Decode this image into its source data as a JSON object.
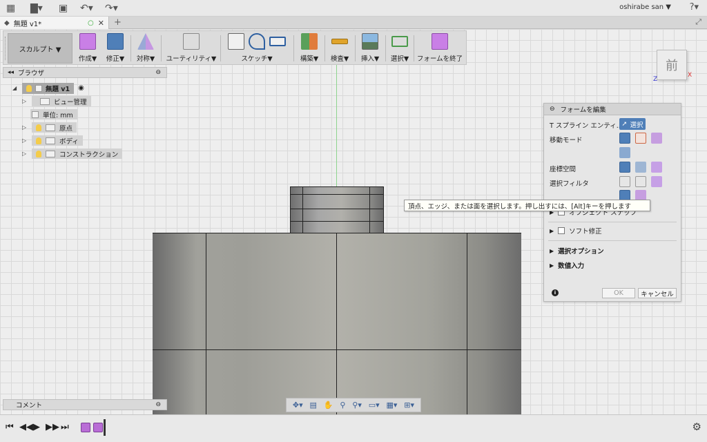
{
  "topbar": {
    "user_name": "oshirabe san ▼",
    "help_label": "?▾"
  },
  "document": {
    "tab_title": "無題 v1*"
  },
  "toolbar": {
    "workspace": "スカルプト ▼",
    "groups": [
      {
        "label": "作成▼"
      },
      {
        "label": "修正▼"
      },
      {
        "label": "対称▼"
      },
      {
        "label": "ユーティリティ▼"
      },
      {
        "label": "スケッチ▼"
      },
      {
        "label": "構築▼"
      },
      {
        "label": "検査▼"
      },
      {
        "label": "挿入▼"
      },
      {
        "label": "選択▼"
      },
      {
        "label": "フォームを終了"
      }
    ]
  },
  "browser": {
    "title": "ブラウザ",
    "root": "無題 v1",
    "items": [
      {
        "label": "ビュー管理"
      },
      {
        "label": "単位: mm"
      },
      {
        "label": "原点"
      },
      {
        "label": "ボディ"
      },
      {
        "label": "コンストラクション"
      }
    ]
  },
  "comment": {
    "title": "コメント"
  },
  "viewcube": {
    "face": "前",
    "x_axis": "X",
    "z_axis": "Z"
  },
  "edit_panel": {
    "title": "フォームを編集",
    "tspline_label": "T スプライン エンティ...",
    "select_button": "選択",
    "move_mode": "移動モード",
    "coordinate_space": "座標空間",
    "selection_filter": "選択フィルタ",
    "hidden_row": "オブジェクト スナップ",
    "soft_modify": "ソフト修正",
    "selection_options": "選択オプション",
    "numeric_input": "数値入力",
    "ok": "OK",
    "cancel": "キャンセル"
  },
  "tooltip": {
    "text": "頂点、エッジ、または面を選択します。押し出すには、[Alt]キーを押します"
  },
  "colors": {
    "accent": "#4f7fb8",
    "feature": "#b96dd6",
    "axis_green": "#8ed48e"
  }
}
